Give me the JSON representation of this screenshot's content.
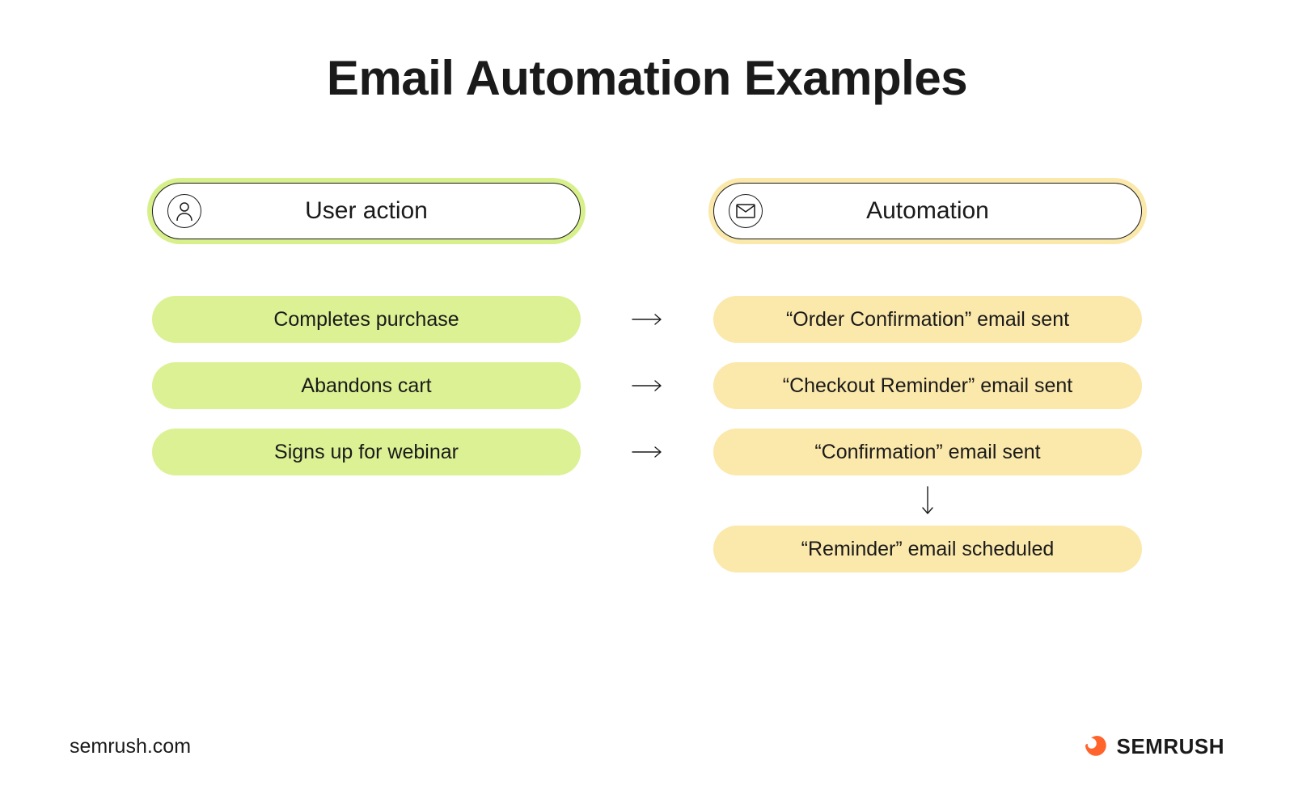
{
  "title": "Email Automation Examples",
  "columns": {
    "left": {
      "header": "User action",
      "items": [
        "Completes purchase",
        "Abandons cart",
        "Signs up for webinar"
      ]
    },
    "right": {
      "header": "Automation",
      "items": [
        "“Order Confirmation” email sent",
        "“Checkout Reminder” email sent",
        "“Confirmation” email sent",
        "“Reminder” email scheduled"
      ]
    }
  },
  "footer": {
    "url": "semrush.com",
    "brand": "SEMRUSH"
  },
  "colors": {
    "green": "#DCF194",
    "yellow": "#FBE8AB",
    "brand_orange": "#FF642D"
  }
}
